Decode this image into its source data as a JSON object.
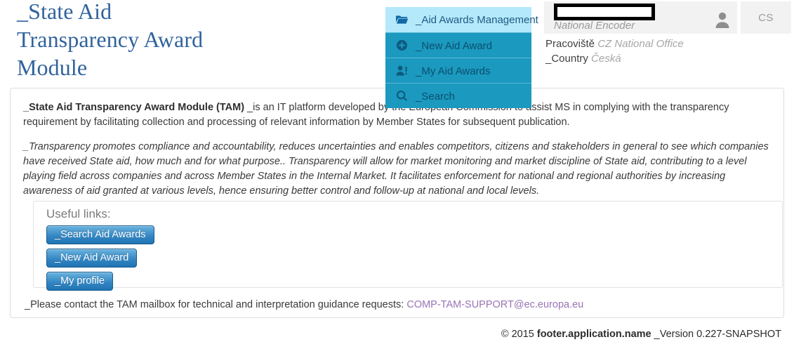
{
  "header": {
    "app_title": "_State Aid Transparency Award Module",
    "user": {
      "name_redacted": "",
      "role": "National Encoder",
      "avatar_icon": "user-icon"
    },
    "language": {
      "code": "CS"
    },
    "org": {
      "office_label": "Pracoviště",
      "office_value": "CZ National Office",
      "country_label": "_Country",
      "country_value": "Česká"
    }
  },
  "nav": {
    "items": [
      {
        "label": "_Aid Awards Management",
        "icon": "folder-open-icon",
        "active": true
      },
      {
        "label": "_New Aid Award",
        "icon": "plus-circle-icon",
        "active": false
      },
      {
        "label": "_My Aid Awards",
        "icon": "user-alert-icon",
        "active": false
      },
      {
        "label": "_Search",
        "icon": "search-icon",
        "active": false
      }
    ]
  },
  "main": {
    "intro_bold": "_State Aid Transparency Award Module (TAM)",
    "intro_rest": " _is an IT platform developed by the European Commission to assist MS in complying with the transparency requirement by facilitating collection and processing of relevant information by Member States for subsequent publication.",
    "transparency_para": "_Transparency promotes compliance and accountability, reduces uncertainties and enables competitors, citizens and stakeholders in general to see which companies have received State aid, how much and for what purpose.. Transparency will allow for market monitoring and market discipline of State aid, contributing to a level playing field across companies and across Member States in the Internal Market. It facilitates enforcement for national and regional authorities by increasing awareness of aid granted at various levels, hence ensuring better control and follow-up at national and local levels.",
    "links": {
      "title": "Useful links:",
      "buttons": [
        "_Search Aid Awards",
        "_New Aid Award",
        "_My profile"
      ]
    },
    "mailbox_text": "_Please contact the TAM mailbox for technical and interpretation guidance requests: ",
    "mailbox_email": "COMP-TAM-SUPPORT@ec.europa.eu"
  },
  "footer": {
    "copyright": "© 2015 ",
    "app_name": "footer.application.name",
    "version": " _Version 0.227-SNAPSHOT"
  },
  "colors": {
    "title_blue": "#31639c",
    "nav_teal": "#1b99bf",
    "nav_active": "#b4e9fb",
    "button_blue": "#3687c3",
    "link_purple": "#9a73b5"
  }
}
